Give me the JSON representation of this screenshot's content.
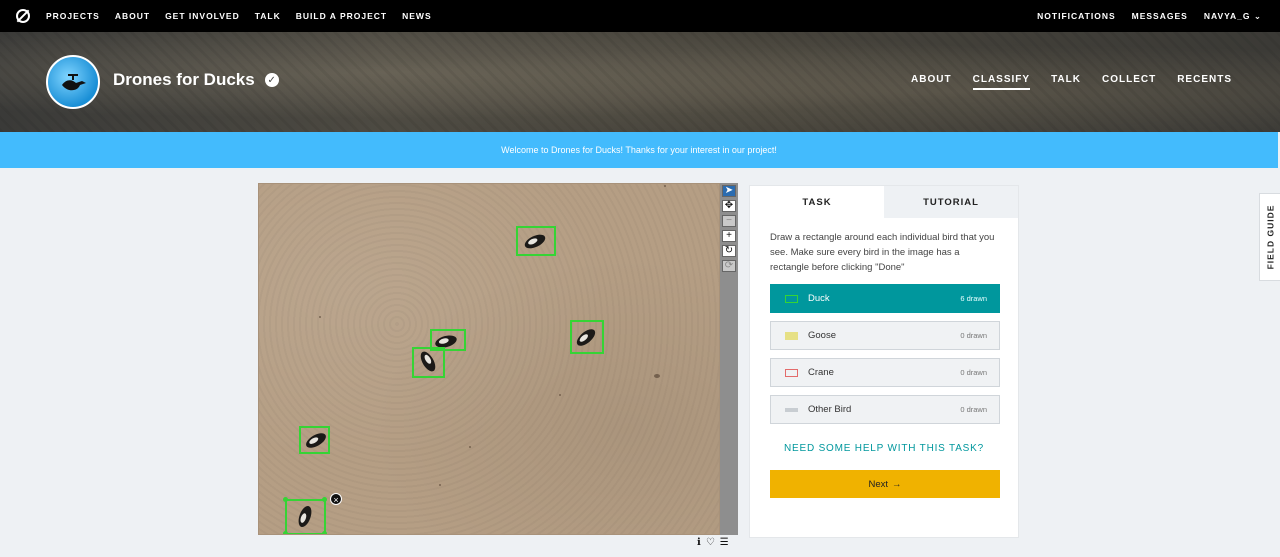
{
  "topnav": {
    "links": [
      "PROJECTS",
      "ABOUT",
      "GET INVOLVED",
      "TALK",
      "BUILD A PROJECT",
      "NEWS"
    ],
    "right": [
      "NOTIFICATIONS",
      "MESSAGES"
    ],
    "user": "NAVYA_G"
  },
  "project": {
    "title": "Drones for Ducks",
    "nav": [
      "ABOUT",
      "CLASSIFY",
      "TALK",
      "COLLECT",
      "RECENTS"
    ],
    "active_nav": "CLASSIFY"
  },
  "banner": {
    "text": "Welcome to Drones for Ducks! Thanks for your interest in our project!"
  },
  "viewer": {
    "tools": [
      "pointer",
      "move",
      "zoom-out",
      "zoom-in",
      "rotate",
      "reset"
    ],
    "delete_label": "×"
  },
  "task": {
    "tabs": [
      "TASK",
      "TUTORIAL"
    ],
    "instructions": "Draw a rectangle around each individual bird that you see. Make sure every bird in the image has a rectangle before clicking \"Done\"",
    "answers": [
      {
        "label": "Duck",
        "count": "6 drawn",
        "color": "#35d435"
      },
      {
        "label": "Goose",
        "count": "0 drawn",
        "color": "#e6e085"
      },
      {
        "label": "Crane",
        "count": "0 drawn",
        "color": "#e36b6b"
      },
      {
        "label": "Other Bird",
        "count": "0 drawn",
        "color": "#c8cdd2"
      }
    ],
    "help": "NEED SOME HELP WITH THIS TASK?",
    "next": "Next"
  },
  "field_guide": "FIELD GUIDE",
  "colors": {
    "accent": "#00979d",
    "banner": "#43bbfd",
    "next_button": "#f0b200",
    "box": "#35d435"
  }
}
